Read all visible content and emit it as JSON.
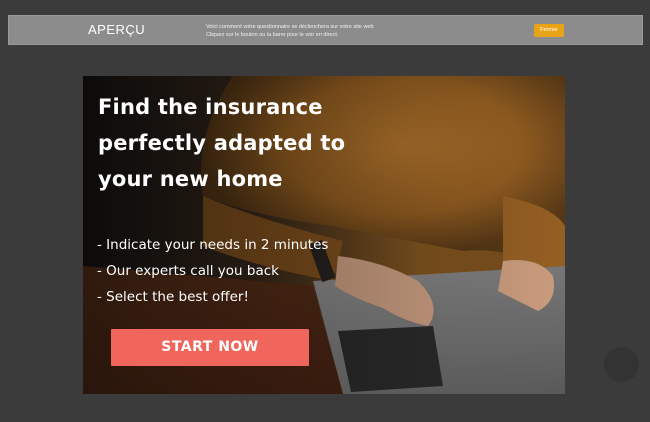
{
  "preview_bar": {
    "title": "APERÇU",
    "description_line1": "Voici comment votre questionnaire se déclenchera sur votre site web",
    "description_line2": "Cliquez sur le bouton ou la barre pour le voir en direct.",
    "close_label": "Fermer"
  },
  "popup": {
    "headline_line1": "Find the insurance",
    "headline_line2": "perfectly adapted to",
    "headline_line3": "your new home",
    "benefits": [
      "- Indicate your needs in 2 minutes",
      "- Our experts call you back",
      "- Select the best offer!"
    ],
    "cta_label": "START NOW"
  },
  "colors": {
    "background": "#3b3b3b",
    "preview_bar": "#8c8c8c",
    "close_button": "#e8a317",
    "cta_button": "#f0665c"
  }
}
